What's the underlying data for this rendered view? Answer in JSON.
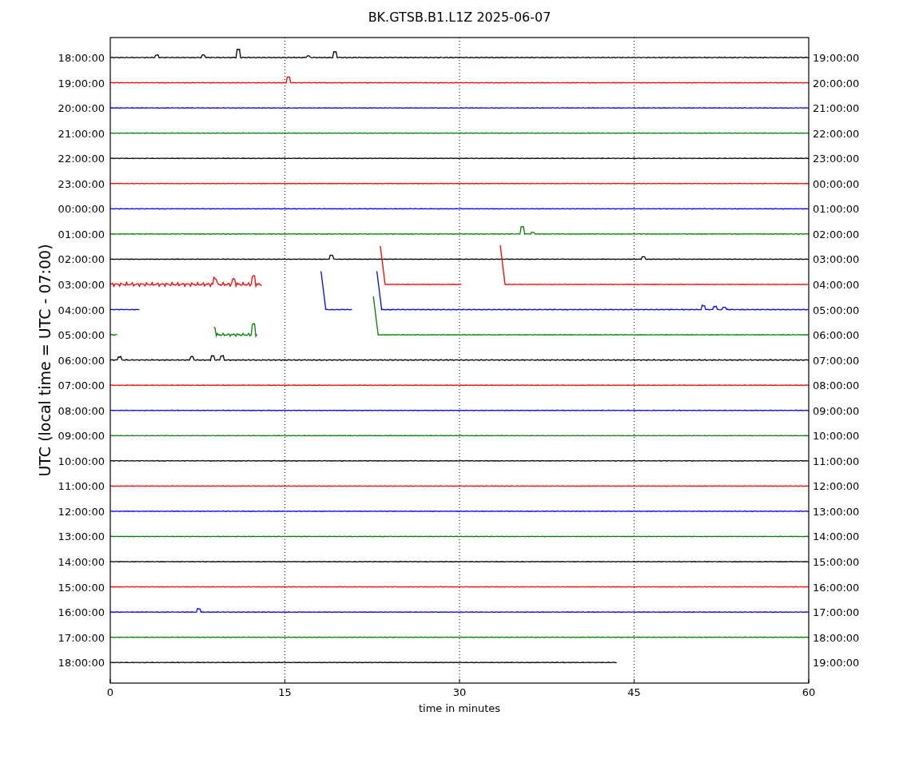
{
  "title": "BK.GTSB.B1.L1Z 2025-06-07",
  "ylabel": "UTC (local time = UTC - 07:00)",
  "xlabel": "time in minutes",
  "xticks": [
    "0",
    "15",
    "30",
    "45",
    "60"
  ],
  "rows": [
    {
      "left": "18:00:00",
      "right": "19:00:00",
      "color": "#000000"
    },
    {
      "left": "19:00:00",
      "right": "20:00:00",
      "color": "#ff0000"
    },
    {
      "left": "20:00:00",
      "right": "21:00:00",
      "color": "#0000ff"
    },
    {
      "left": "21:00:00",
      "right": "22:00:00",
      "color": "#008000"
    },
    {
      "left": "22:00:00",
      "right": "23:00:00",
      "color": "#000000"
    },
    {
      "left": "23:00:00",
      "right": "00:00:00",
      "color": "#ff0000"
    },
    {
      "left": "00:00:00",
      "right": "01:00:00",
      "color": "#0000ff"
    },
    {
      "left": "01:00:00",
      "right": "02:00:00",
      "color": "#008000"
    },
    {
      "left": "02:00:00",
      "right": "03:00:00",
      "color": "#000000"
    },
    {
      "left": "03:00:00",
      "right": "04:00:00",
      "color": "#ff0000"
    },
    {
      "left": "04:00:00",
      "right": "05:00:00",
      "color": "#0000ff"
    },
    {
      "left": "05:00:00",
      "right": "06:00:00",
      "color": "#008000"
    },
    {
      "left": "06:00:00",
      "right": "07:00:00",
      "color": "#000000"
    },
    {
      "left": "07:00:00",
      "right": "08:00:00",
      "color": "#ff0000"
    },
    {
      "left": "08:00:00",
      "right": "09:00:00",
      "color": "#0000ff"
    },
    {
      "left": "09:00:00",
      "right": "10:00:00",
      "color": "#008000"
    },
    {
      "left": "10:00:00",
      "right": "11:00:00",
      "color": "#000000"
    },
    {
      "left": "11:00:00",
      "right": "12:00:00",
      "color": "#ff0000"
    },
    {
      "left": "12:00:00",
      "right": "13:00:00",
      "color": "#0000ff"
    },
    {
      "left": "13:00:00",
      "right": "14:00:00",
      "color": "#008000"
    },
    {
      "left": "14:00:00",
      "right": "15:00:00",
      "color": "#000000"
    },
    {
      "left": "15:00:00",
      "right": "16:00:00",
      "color": "#ff0000"
    },
    {
      "left": "16:00:00",
      "right": "17:00:00",
      "color": "#0000ff"
    },
    {
      "left": "17:00:00",
      "right": "18:00:00",
      "color": "#008000"
    },
    {
      "left": "18:00:00",
      "right": "19:00:00",
      "color": "#000000"
    }
  ]
}
